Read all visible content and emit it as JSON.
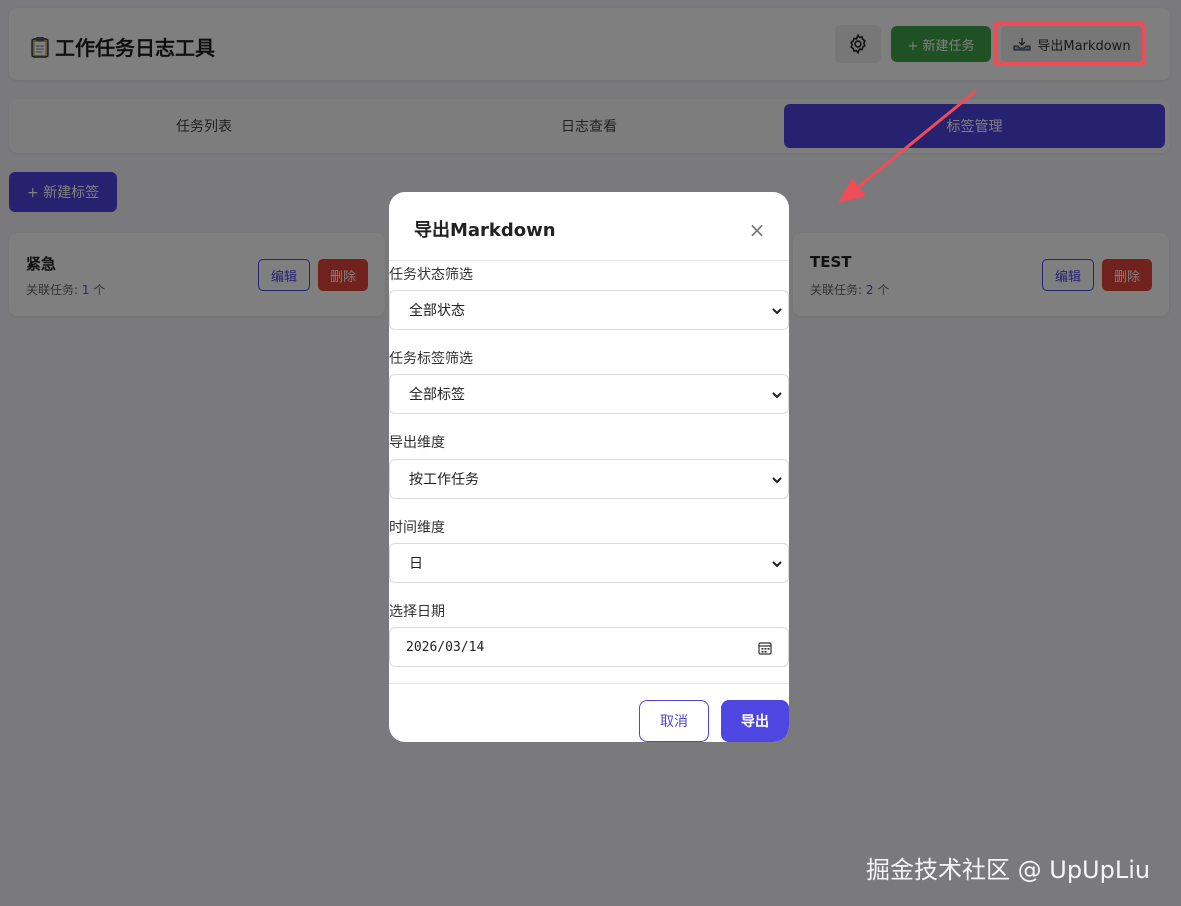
{
  "header": {
    "title": "工作任务日志工具",
    "new_task_label": "+ 新建任务",
    "export_label": "导出Markdown"
  },
  "tabs": [
    {
      "label": "任务列表",
      "active": false
    },
    {
      "label": "日志查看",
      "active": false
    },
    {
      "label": "标签管理",
      "active": true
    }
  ],
  "tags_page": {
    "new_tag_label": "+ 新建标签",
    "cards": [
      {
        "name": "紧急",
        "count_prefix": "关联任务: ",
        "count": "1",
        "count_suffix": " 个",
        "edit_label": "编辑",
        "delete_label": "删除"
      },
      {
        "name": "TEST",
        "count_prefix": "关联任务: ",
        "count": "2",
        "count_suffix": " 个",
        "edit_label": "编辑",
        "delete_label": "删除"
      }
    ]
  },
  "modal": {
    "title": "导出Markdown",
    "close_glyph": "×",
    "fields": [
      {
        "label": "任务状态筛选",
        "value": "全部状态"
      },
      {
        "label": "任务标签筛选",
        "value": "全部标签"
      },
      {
        "label": "导出维度",
        "value": "按工作任务"
      },
      {
        "label": "时间维度",
        "value": "日"
      }
    ],
    "date_field": {
      "label": "选择日期",
      "value": "2026/03/14"
    },
    "cancel_label": "取消",
    "confirm_label": "导出"
  },
  "watermark": "掘金技术社区 @ UpUpLiu",
  "colors": {
    "accent": "#4f45e0",
    "success": "#40a34a",
    "danger": "#e0453b",
    "highlight": "#ef4c57"
  },
  "icons": {
    "app": "clipboard-icon",
    "settings": "gear-icon",
    "export": "tray-download-icon",
    "select": "chevron-down-icon",
    "date": "calendar-icon",
    "close": "close-icon"
  }
}
